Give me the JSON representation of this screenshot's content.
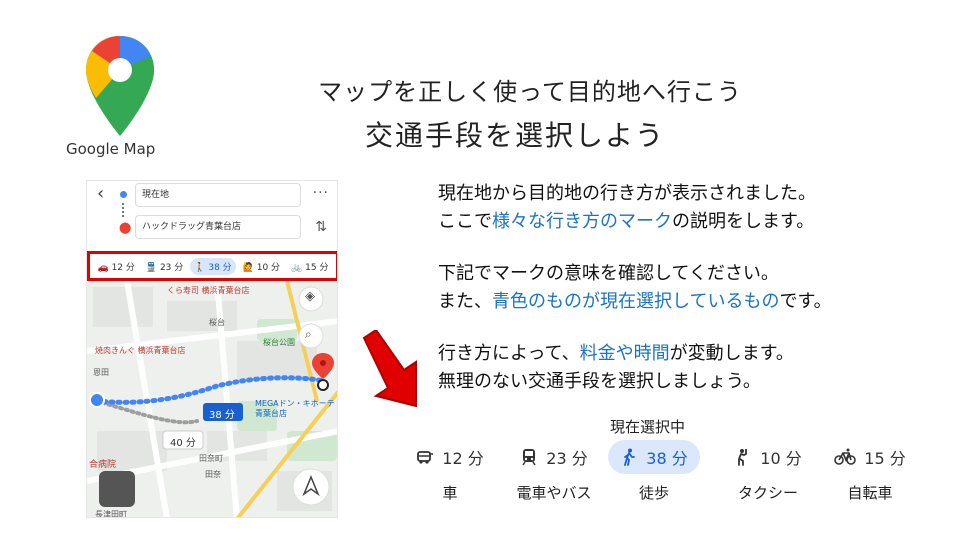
{
  "logo": {
    "label": "Google Map"
  },
  "title": {
    "line1": "マップを正しく使って目的地へ行こう",
    "line2": "交通手段を選択しよう"
  },
  "phone": {
    "origin": "現在地",
    "destination": "ハックドラッグ青葉台店",
    "modes": [
      {
        "icon": "car-icon",
        "label": "12 分"
      },
      {
        "icon": "train-icon",
        "label": "23 分"
      },
      {
        "icon": "walk-icon",
        "label": "38 分",
        "selected": true
      },
      {
        "icon": "rideshare-icon",
        "label": "10 分"
      },
      {
        "icon": "bicycle-icon",
        "label": "15 分"
      }
    ],
    "map_labels": {
      "l1": "くら寿司 横浜青葉台店",
      "l2": "焼肉きんぐ 横浜青葉台店",
      "l3": "桜台",
      "l4": "桜台公園",
      "l5": "恩田",
      "l6": "MEGAドン・キホーテ青葉台店",
      "l7": "田奈町",
      "l8": "田奈",
      "l9": "合病院",
      "l10": "長津田町",
      "route_walk": "38 分",
      "route_alt": "40 分"
    }
  },
  "description": {
    "p1a": "現在地から目的地の行き方が表示されました。",
    "p1b_pre": "ここで",
    "p1b_hl": "様々な行き方のマーク",
    "p1b_post": "の説明をします。",
    "p2a": "下記でマークの意味を確認してください。",
    "p2b_pre": "また、",
    "p2b_hl": "青色のものが現在選択しているもの",
    "p2b_post": "です。",
    "p3a_pre": "行き方によって、",
    "p3a_hl": "料金や時間",
    "p3a_post": "が変動します。",
    "p3b": "無理のない交通手段を選択しましょう。"
  },
  "current_label": "現在選択中",
  "modes": [
    {
      "icon": "car-icon",
      "time": "12 分",
      "name": "車"
    },
    {
      "icon": "train-icon",
      "time": "23 分",
      "name": "電車やバス"
    },
    {
      "icon": "walk-icon",
      "time": "38 分",
      "name": "徒歩",
      "selected": true
    },
    {
      "icon": "rideshare-icon",
      "time": "10 分",
      "name": "タクシー"
    },
    {
      "icon": "bicycle-icon",
      "time": "15 分",
      "name": "自転車"
    }
  ],
  "colors": {
    "highlight": "#1a73c8",
    "selected_bg": "#dbe8fb",
    "frame_red": "#e00000",
    "route_blue": "#4285f4"
  }
}
